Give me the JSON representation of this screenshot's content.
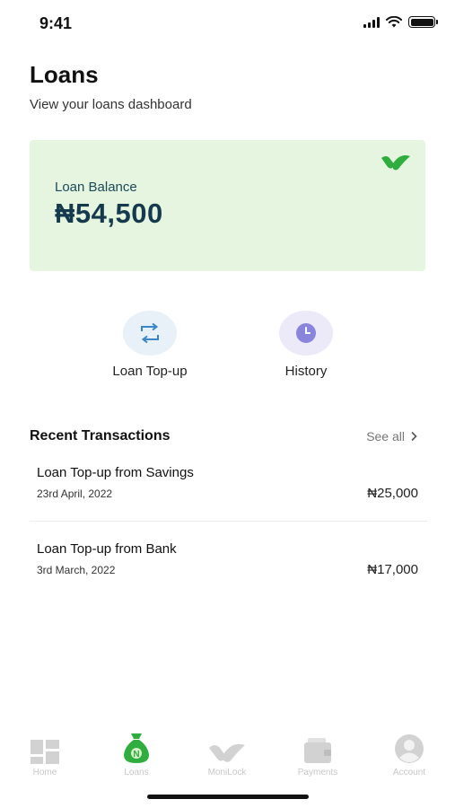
{
  "status_bar": {
    "time": "9:41"
  },
  "header": {
    "title": "Loans",
    "subtitle": "View your loans dashboard"
  },
  "balance_card": {
    "label": "Loan Balance",
    "amount": "₦54,500"
  },
  "actions": [
    {
      "label": "Loan Top-up",
      "icon": "swap-arrows-icon"
    },
    {
      "label": "History",
      "icon": "clock-icon"
    }
  ],
  "recent_transactions": {
    "title": "Recent Transactions",
    "see_all": "See all",
    "items": [
      {
        "title": "Loan Top-up from Savings",
        "date": "23rd April, 2022",
        "amount": "₦25,000"
      },
      {
        "title": "Loan Top-up from Bank",
        "date": "3rd March, 2022",
        "amount": "₦17,000"
      }
    ]
  },
  "tab_bar": {
    "tabs": [
      {
        "label": "Home",
        "icon": "home-grid-icon"
      },
      {
        "label": "Loans",
        "icon": "money-bag-icon",
        "active": true
      },
      {
        "label": "MoniLock",
        "icon": "monilock-logo-icon"
      },
      {
        "label": "Payments",
        "icon": "wallet-icon"
      },
      {
        "label": "Account",
        "icon": "user-icon"
      }
    ]
  },
  "colors": {
    "card_background": "#e6f5df",
    "brand_green": "#2fae3f",
    "balance_text": "#163a4d",
    "inactive_tab": "#c8c8c8"
  }
}
